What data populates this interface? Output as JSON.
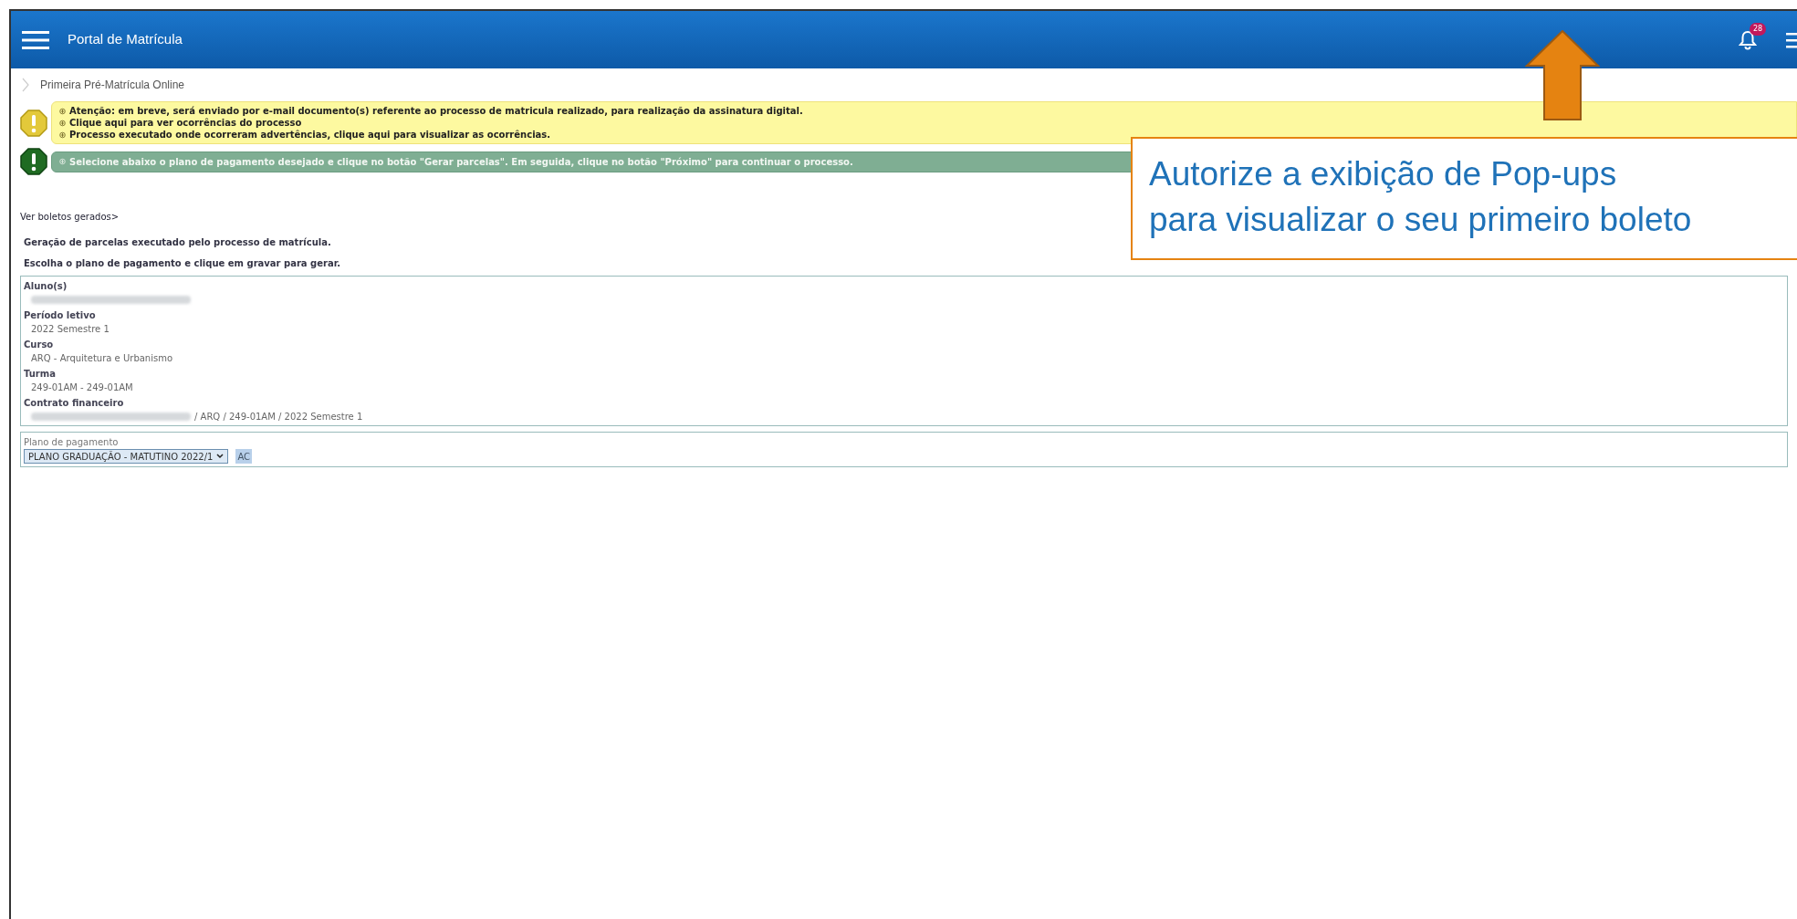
{
  "header": {
    "title": "Portal de Matrícula",
    "notification_count": "28"
  },
  "breadcrumb": "Primeira Pré-Matrícula Online",
  "alerts": [
    {
      "kind": "warning",
      "lines": [
        "Atenção: em breve, será enviado por e-mail documento(s) referente ao processo de matricula realizado, para realização da assinatura digital.",
        "Clique aqui para ver ocorrências do processo",
        "Processo executado onde ocorreram advertências, clique aqui para visualizar as ocorrências."
      ]
    },
    {
      "kind": "info",
      "lines": [
        "Selecione abaixo o plano de pagamento desejado e clique no botão \"Gerar parcelas\". Em seguida, clique no botão \"Próximo\" para continuar o processo."
      ]
    }
  ],
  "link": "Ver boletos gerados>",
  "instructions": [
    "Geração de parcelas executado pelo processo de matrícula.",
    "Escolha o plano de pagamento e clique em gravar para gerar."
  ],
  "details": [
    {
      "label": "Aluno(s)",
      "redacted": true
    },
    {
      "label": "Período letivo",
      "value": "2022 Semestre 1"
    },
    {
      "label": "Curso",
      "value": "ARQ - Arquitetura e Urbanismo"
    },
    {
      "label": "Turma",
      "value": "249-01AM - 249-01AM"
    },
    {
      "label": "Contrato financeiro",
      "redacted": true,
      "value": "/ ARQ / 249-01AM / 2022 Semestre 1"
    }
  ],
  "payment_plan": {
    "label": "Plano de pagamento",
    "value": "PLANO GRADUAÇÃO - MATUTINO 2022/1",
    "button": "AC"
  },
  "callout": {
    "text": "Autorize a exibição de Pop-ups\npara visualizar o seu primeiro boleto"
  }
}
